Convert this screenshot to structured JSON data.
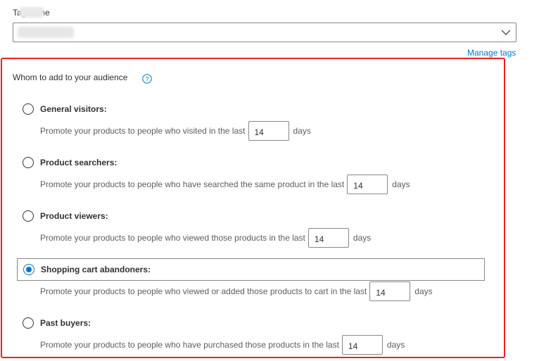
{
  "tag_field": {
    "label": "Tag name",
    "value": ""
  },
  "manage_tags": "Manage tags",
  "section": {
    "title": "Whom to add to your audience"
  },
  "options": [
    {
      "label": "General visitors:",
      "checked": false,
      "description": "Promote your products to people who visited in the last",
      "days_value": "14",
      "days_unit": "days"
    },
    {
      "label": "Product searchers:",
      "checked": false,
      "description": "Promote your products to people who have searched the same product in the last",
      "days_value": "14",
      "days_unit": "days"
    },
    {
      "label": "Product viewers:",
      "checked": false,
      "description": "Promote your products to people who viewed those products in the last",
      "days_value": "14",
      "days_unit": "days"
    },
    {
      "label": "Shopping cart abandoners:",
      "checked": true,
      "description": "Promote your products to people who viewed or added those products to cart in the last",
      "days_value": "14",
      "days_unit": "days"
    },
    {
      "label": "Past buyers:",
      "checked": false,
      "description": "Promote your products to people who have purchased those products in the last",
      "days_value": "14",
      "days_unit": "days"
    }
  ],
  "colors": {
    "accent": "#0078d4",
    "highlight_border": "#e8231d"
  },
  "icons": {
    "dropdown": "chevron-down-icon",
    "help": "help-circle-icon"
  }
}
